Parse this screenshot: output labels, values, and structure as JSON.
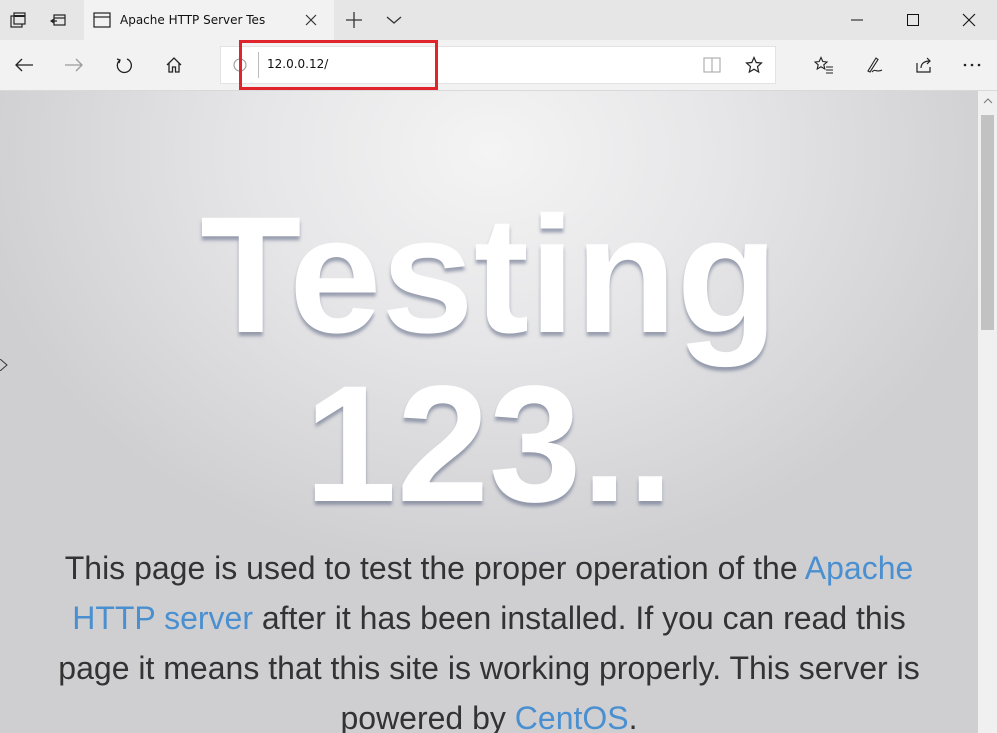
{
  "browser": {
    "tab": {
      "title": "Apache HTTP Server Tes"
    },
    "address": {
      "url": "12.0.0.12/"
    },
    "highlight_color": "#e0242c",
    "icons": {
      "tab_manager": "tab-manager-icon",
      "set_aside": "set-aside-tabs-icon",
      "favicon": "page-icon",
      "close_tab": "close-icon",
      "new_tab": "plus-icon",
      "tab_list": "chevron-down-icon",
      "minimize": "minimize-icon",
      "maximize": "maximize-icon",
      "close_window": "close-icon",
      "back": "back-arrow-icon",
      "forward": "forward-arrow-icon",
      "refresh": "refresh-icon",
      "home": "home-icon",
      "site_info": "info-icon",
      "reading_view": "book-icon",
      "favorite": "star-icon",
      "favorites_hub": "favorites-list-icon",
      "notes": "pen-icon",
      "share": "share-icon",
      "more": "more-icon"
    }
  },
  "page": {
    "heading_line1": "Testing",
    "heading_line2": "123..",
    "paragraph": {
      "part1": "This page is used to test the proper operation of the ",
      "link1": "Apache HTTP server",
      "part2": " after it has been installed. If you can read this page it means that this site is working properly. This server is powered by ",
      "link2": "CentOS",
      "part3": "."
    },
    "link_color": "#4a90d0",
    "text_color": "#333333"
  }
}
